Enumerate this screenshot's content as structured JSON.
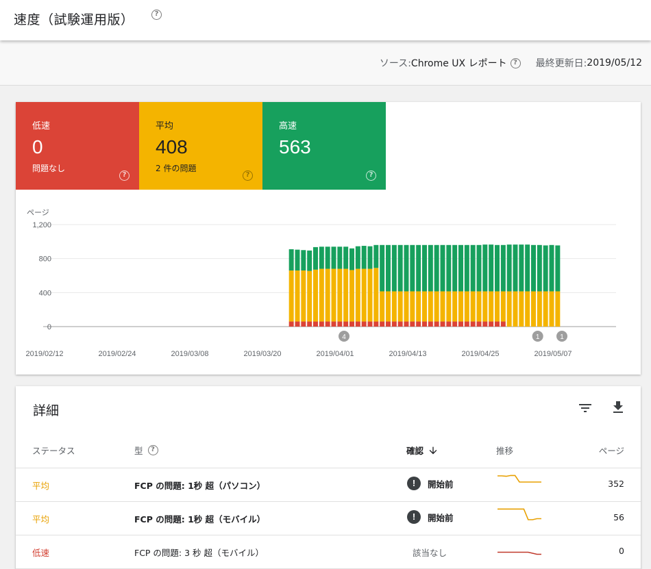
{
  "header": {
    "title": "速度（試験運用版）",
    "help_icon": "help-circle-icon"
  },
  "subheader": {
    "source_label": "ソース: ",
    "source_value": "Chrome UX レポート",
    "updated_label": "最終更新日: ",
    "updated_value": "2019/05/12"
  },
  "summary": [
    {
      "label": "低速",
      "count": "0",
      "sub": "問題なし",
      "color": "#db4437"
    },
    {
      "label": "平均",
      "count": "408",
      "sub": "2 件の問題",
      "color": "#f4b400"
    },
    {
      "label": "高速",
      "count": "563",
      "sub": "",
      "color": "#17a05d"
    }
  ],
  "chart_data": {
    "type": "bar",
    "stacked": true,
    "ylabel": "ページ",
    "ylim": [
      0,
      1200
    ],
    "yticks": [
      "0",
      "400",
      "800",
      "1,200"
    ],
    "xtick_labels": [
      "2019/02/12",
      "2019/02/24",
      "2019/03/08",
      "2019/03/20",
      "2019/04/01",
      "2019/04/13",
      "2019/04/25",
      "2019/05/07"
    ],
    "x_start": "2019/03/22",
    "series": [
      {
        "name": "低速",
        "color": "#db4437",
        "values": [
          60,
          60,
          60,
          60,
          60,
          60,
          60,
          60,
          60,
          60,
          60,
          60,
          60,
          60,
          60,
          60,
          60,
          60,
          60,
          60,
          60,
          60,
          60,
          60,
          60,
          60,
          60,
          60,
          60,
          60,
          60,
          60,
          60,
          60,
          60,
          60,
          0,
          0,
          0,
          0,
          0,
          0,
          0,
          0,
          0
        ]
      },
      {
        "name": "平均",
        "color": "#f4b400",
        "values": [
          600,
          600,
          600,
          595,
          610,
          620,
          620,
          620,
          620,
          620,
          605,
          620,
          620,
          620,
          630,
          355,
          355,
          355,
          355,
          355,
          355,
          355,
          355,
          355,
          355,
          355,
          355,
          355,
          355,
          355,
          355,
          355,
          355,
          355,
          355,
          355,
          415,
          415,
          415,
          415,
          415,
          415,
          415,
          415,
          415
        ]
      },
      {
        "name": "高速",
        "color": "#17a05d",
        "values": [
          250,
          245,
          240,
          240,
          265,
          260,
          260,
          260,
          260,
          260,
          255,
          265,
          270,
          265,
          270,
          545,
          545,
          545,
          545,
          545,
          545,
          545,
          545,
          545,
          545,
          545,
          545,
          545,
          545,
          545,
          545,
          545,
          550,
          550,
          545,
          545,
          550,
          550,
          550,
          550,
          545,
          545,
          540,
          545,
          540
        ]
      }
    ],
    "annotations": [
      {
        "label": "4",
        "date": "2019/04/01"
      },
      {
        "label": "1",
        "date": "2019/05/03"
      },
      {
        "label": "1",
        "date": "2019/05/07"
      }
    ],
    "grid": true
  },
  "details": {
    "title": "詳細",
    "filter_icon": "filter-icon",
    "download_icon": "download-icon",
    "columns": {
      "status": "ステータス",
      "type": "型",
      "confirm": "確認",
      "trend": "推移",
      "pages": "ページ"
    },
    "rows": [
      {
        "status": "平均",
        "type": "FCP の問題: 1秒 超（パソコン）",
        "confirm": "開始前",
        "pages": "352",
        "trend": [
          0.9,
          0.9,
          0.88,
          0.92,
          0.92,
          0.6,
          0.6,
          0.6,
          0.6,
          0.6,
          0.6
        ],
        "trend_color": "#e8a000"
      },
      {
        "status": "平均",
        "type": "FCP の問題: 1秒 超（モバイル）",
        "confirm": "開始前",
        "pages": "56",
        "trend": [
          0.92,
          0.92,
          0.92,
          0.92,
          0.92,
          0.92,
          0.92,
          0.4,
          0.4,
          0.45,
          0.45
        ],
        "trend_color": "#e8a000"
      },
      {
        "status": "低速",
        "type": "FCP の問題: 3 秒 超（モバイル）",
        "confirm": "該当なし",
        "pages": "0",
        "trend": [
          0.45,
          0.45,
          0.45,
          0.45,
          0.45,
          0.45,
          0.45,
          0.45,
          0.4,
          0.35,
          0.35
        ],
        "trend_color": "#c0392b"
      }
    ]
  }
}
